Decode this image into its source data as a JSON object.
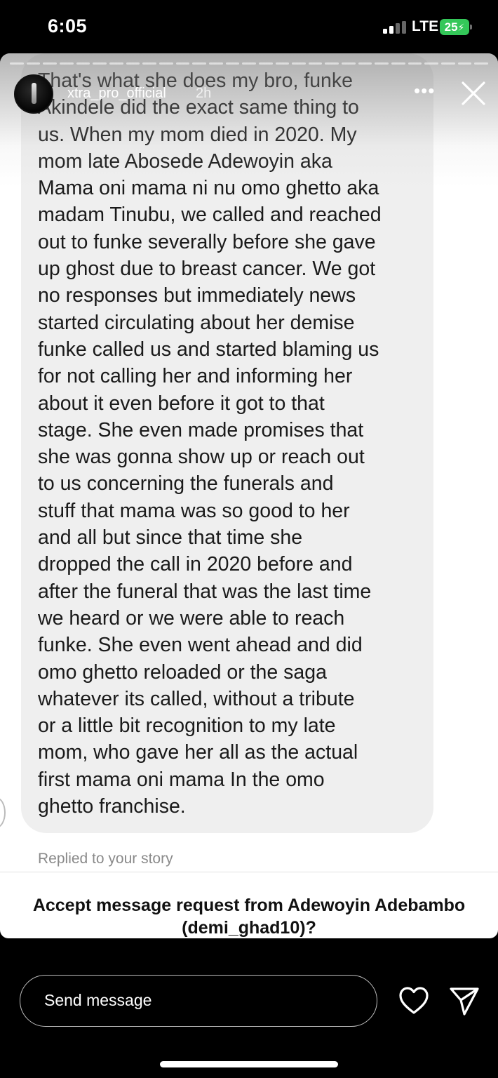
{
  "status_bar": {
    "time": "6:05",
    "network": "LTE",
    "battery": "25"
  },
  "story": {
    "username": "xtra_pro_official",
    "time_ago": "2h",
    "more_label": "•••"
  },
  "message": {
    "text": "That's what she does my bro, funke\nAkindele did the exact same thing to\nus. When my mom died in 2020. My\nmom late Abosede Adewoyin aka\nMama oni mama ni nu omo ghetto aka\nmadam Tinubu, we called and reached\nout to funke severally before she gave\nup ghost due to breast cancer. We got\nno responses but immediately news\nstarted circulating about her demise\nfunke called us and started blaming us\nfor not calling her and informing her\nabout it even before it got to that\nstage. She even made promises that\nshe was gonna show up or reach out\nto us concerning the funerals and\nstuff that mama was so good to her\nand all but since that time she\ndropped the call in 2020 before and\nafter the funeral that was the last time\nwe heard or we were able to reach\nfunke. She even went ahead and did\nomo ghetto reloaded or the saga\nwhatever its called, without a tribute\nor a little bit recognition to my late\nmom, who gave her all as the actual\nfirst mama oni mama In the omo\nghetto franchise.",
    "replied_label": "Replied to your story"
  },
  "request": {
    "prompt": "Accept message request from Adewoyin Adebambo\n(demi_ghad10)?"
  },
  "composer": {
    "placeholder": "Send message"
  },
  "colors": {
    "background": "#000000",
    "bubble": "#efefef",
    "battery": "#34c759"
  },
  "icons": [
    "cell-signal-icon",
    "battery-icon",
    "close-icon",
    "more-icon",
    "heart-icon",
    "send-icon"
  ]
}
